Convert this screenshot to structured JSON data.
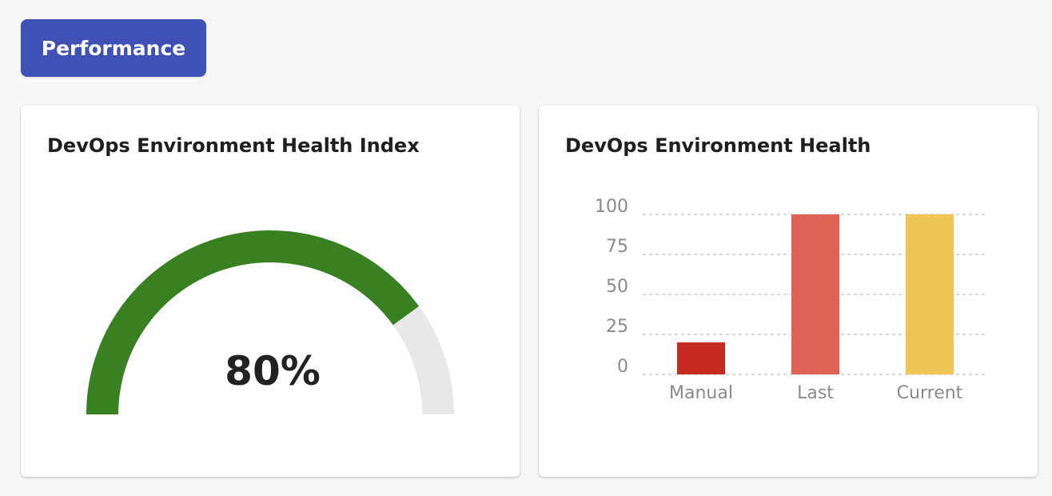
{
  "header": {
    "performance_button_label": "Performance",
    "accent_color": "#3f51b5"
  },
  "gauge_card": {
    "title": "DevOps Environment Health Index",
    "value_text": "80%",
    "percent": 80,
    "fill_color": "#388021",
    "track_color": "#e8e8e8"
  },
  "chart_data": {
    "type": "bar",
    "title": "DevOps Environment Health",
    "categories": [
      "Manual",
      "Last",
      "Current"
    ],
    "values": [
      20,
      100,
      100
    ],
    "colors": [
      "#c62b21",
      "#e06456",
      "#efc655"
    ],
    "yticks": [
      0,
      25,
      50,
      75,
      100
    ],
    "ylim": [
      0,
      100
    ],
    "xlabel": "",
    "ylabel": "",
    "grid": true
  }
}
